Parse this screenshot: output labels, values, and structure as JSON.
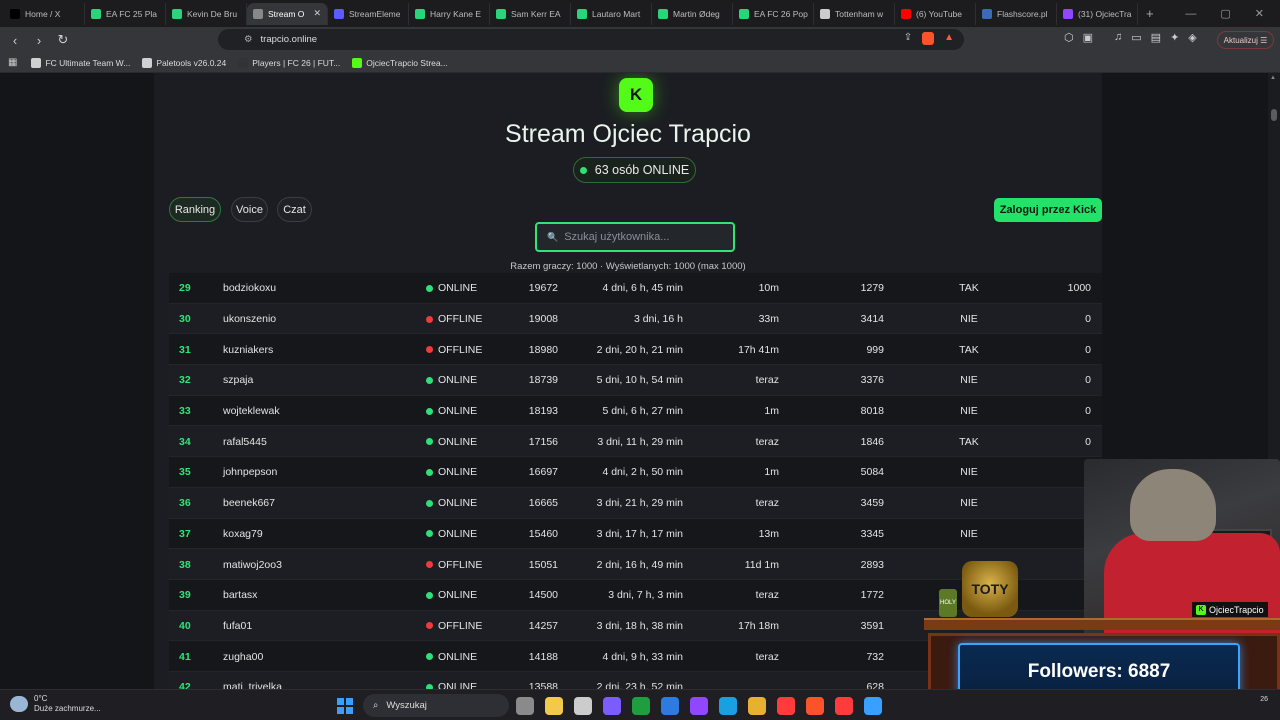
{
  "browser": {
    "tabs": [
      {
        "label": "Home / X",
        "icon_color": "#000000",
        "active": false
      },
      {
        "label": "EA FC 25 Pla",
        "icon_color": "#2bd47a",
        "active": false
      },
      {
        "label": "Kevin De Bru",
        "icon_color": "#2bd47a",
        "active": false
      },
      {
        "label": "Stream O",
        "icon_color": "#888888",
        "active": true
      },
      {
        "label": "StreamEleme",
        "icon_color": "#5b5bff",
        "active": false
      },
      {
        "label": "Harry Kane E",
        "icon_color": "#2bd47a",
        "active": false
      },
      {
        "label": "Sam Kerr EA",
        "icon_color": "#2bd47a",
        "active": false
      },
      {
        "label": "Lautaro Mart",
        "icon_color": "#2bd47a",
        "active": false
      },
      {
        "label": "Martin Ødeg",
        "icon_color": "#2bd47a",
        "active": false
      },
      {
        "label": "EA FC 26 Pop",
        "icon_color": "#2bd47a",
        "active": false
      },
      {
        "label": "Tottenham w",
        "icon_color": "#cccccc",
        "active": false
      },
      {
        "label": "(6) YouTube",
        "icon_color": "#ff0000",
        "active": false
      },
      {
        "label": "Flashscore.pl",
        "icon_color": "#3c6bb5",
        "active": false
      },
      {
        "label": "(31) OjciecTra",
        "icon_color": "#9146ff",
        "active": false
      }
    ],
    "url": "trapcio.online",
    "update_label": "Aktualizuj",
    "bookmarks": [
      {
        "label": "FC Ultimate Team W...",
        "icon_color": "#d0d0d0"
      },
      {
        "label": "Paletools v26.0.24",
        "icon_color": "#d0d0d0"
      },
      {
        "label": "Players | FC 26 | FUT...",
        "icon_color": "#333333"
      },
      {
        "label": "OjciecTrapcio Strea...",
        "icon_color": "#53fc18"
      }
    ]
  },
  "site": {
    "logo_letter": "K",
    "title": "Stream Ojciec Trapcio",
    "online_text": "63 osób ONLINE",
    "nav": [
      "Ranking",
      "Voice",
      "Czat"
    ],
    "login_label": "Zaloguj przez Kick",
    "search_placeholder": "Szukaj użytkownika...",
    "summary": "Razem graczy: 1000 · Wyświetlanych: 1000 (max 1000)",
    "accent_color": "#2ee575"
  },
  "rows": [
    {
      "rank": "29",
      "name": "bodziokoxu",
      "status": "ONLINE",
      "points": "19672",
      "time": "4 dni, 6 h, 45 min",
      "last": "10m",
      "msgs": "1279",
      "sub": "TAK",
      "bet": "1000"
    },
    {
      "rank": "30",
      "name": "ukonszenio",
      "status": "OFFLINE",
      "points": "19008",
      "time": "3 dni, 16 h",
      "last": "33m",
      "msgs": "3414",
      "sub": "NIE",
      "bet": "0"
    },
    {
      "rank": "31",
      "name": "kuzniakers",
      "status": "OFFLINE",
      "points": "18980",
      "time": "2 dni, 20 h, 21 min",
      "last": "17h 41m",
      "msgs": "999",
      "sub": "TAK",
      "bet": "0"
    },
    {
      "rank": "32",
      "name": "szpaja",
      "status": "ONLINE",
      "points": "18739",
      "time": "5 dni, 10 h, 54 min",
      "last": "teraz",
      "msgs": "3376",
      "sub": "NIE",
      "bet": "0"
    },
    {
      "rank": "33",
      "name": "wojteklewak",
      "status": "ONLINE",
      "points": "18193",
      "time": "5 dni, 6 h, 27 min",
      "last": "1m",
      "msgs": "8018",
      "sub": "NIE",
      "bet": "0"
    },
    {
      "rank": "34",
      "name": "rafal5445",
      "status": "ONLINE",
      "points": "17156",
      "time": "3 dni, 11 h, 29 min",
      "last": "teraz",
      "msgs": "1846",
      "sub": "TAK",
      "bet": "0"
    },
    {
      "rank": "35",
      "name": "johnpepson",
      "status": "ONLINE",
      "points": "16697",
      "time": "4 dni, 2 h, 50 min",
      "last": "1m",
      "msgs": "5084",
      "sub": "NIE",
      "bet": "0"
    },
    {
      "rank": "36",
      "name": "beenek667",
      "status": "ONLINE",
      "points": "16665",
      "time": "3 dni, 21 h, 29 min",
      "last": "teraz",
      "msgs": "3459",
      "sub": "NIE",
      "bet": "0"
    },
    {
      "rank": "37",
      "name": "koxag79",
      "status": "ONLINE",
      "points": "15460",
      "time": "3 dni, 17 h, 17 min",
      "last": "13m",
      "msgs": "3345",
      "sub": "NIE",
      "bet": "0"
    },
    {
      "rank": "38",
      "name": "matiwoj2oo3",
      "status": "OFFLINE",
      "points": "15051",
      "time": "2 dni, 16 h, 49 min",
      "last": "11d 1m",
      "msgs": "2893",
      "sub": "",
      "bet": ""
    },
    {
      "rank": "39",
      "name": "bartasx",
      "status": "ONLINE",
      "points": "14500",
      "time": "3 dni, 7 h, 3 min",
      "last": "teraz",
      "msgs": "1772",
      "sub": "",
      "bet": ""
    },
    {
      "rank": "40",
      "name": "fufa01",
      "status": "OFFLINE",
      "points": "14257",
      "time": "3 dni, 18 h, 38 min",
      "last": "17h 18m",
      "msgs": "3591",
      "sub": "",
      "bet": ""
    },
    {
      "rank": "41",
      "name": "zugha00",
      "status": "ONLINE",
      "points": "14188",
      "time": "4 dni, 9 h, 33 min",
      "last": "teraz",
      "msgs": "732",
      "sub": "",
      "bet": ""
    },
    {
      "rank": "42",
      "name": "mati_trivelka",
      "status": "ONLINE",
      "points": "13588",
      "time": "2 dni, 23 h, 52 min",
      "last": "",
      "msgs": "628",
      "sub": "",
      "bet": ""
    }
  ],
  "overlay": {
    "cam_label": "OjciecTrapcio",
    "followers_text": "Followers: 6887",
    "toty_text": "TOTY",
    "holy_text": "HOLY"
  },
  "taskbar": {
    "temp": "0°C",
    "weather_desc": "Duże zachmurze...",
    "search_label": "Wyszukaj",
    "icon_colors": [
      "#8a8a8a",
      "#f2c94c",
      "#cccccc",
      "#7b5cff",
      "#1e9e3e",
      "#2d7be0",
      "#9146ff",
      "#1aa0e0",
      "#e8b030",
      "#ff3b3b",
      "#fb542b",
      "#ff3b3b",
      "#3aa0ff"
    ],
    "clock": "26"
  }
}
